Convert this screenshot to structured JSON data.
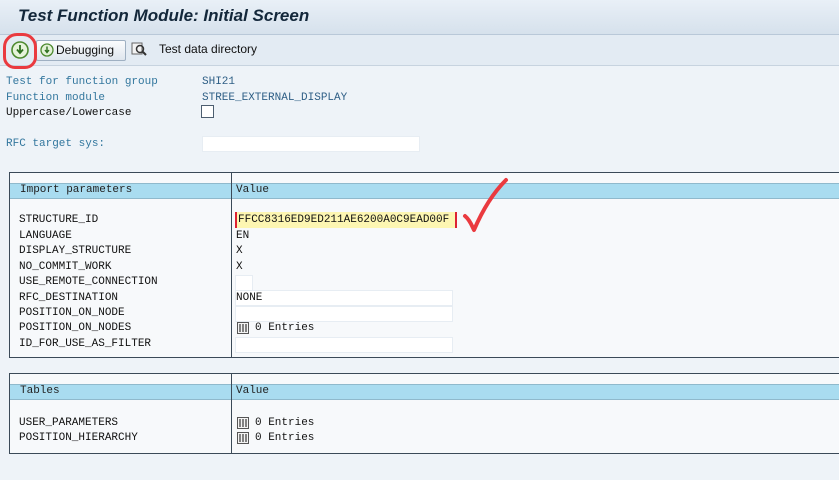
{
  "window": {
    "title": "Test Function Module: Initial Screen"
  },
  "toolbar": {
    "execute_icon": "execute-icon",
    "debugging_label": "Debugging",
    "test_data_directory_label": "Test data directory"
  },
  "header_fields": [
    {
      "label": "Test for function group",
      "value": "SHI21"
    },
    {
      "label": "Function module",
      "value": "STREE_EXTERNAL_DISPLAY"
    },
    {
      "label": "Uppercase/Lowercase",
      "value": ""
    },
    {
      "label": "RFC target sys:",
      "value": ""
    }
  ],
  "import_table": {
    "col_param": "Import parameters",
    "col_value": "Value",
    "rows": [
      {
        "name": "STRUCTURE_ID",
        "value": "FFCC8316ED9ED211AE6200A0C9EAD00F"
      },
      {
        "name": "LANGUAGE",
        "value": "EN"
      },
      {
        "name": "DISPLAY_STRUCTURE",
        "value": "X"
      },
      {
        "name": "NO_COMMIT_WORK",
        "value": "X"
      },
      {
        "name": "USE_REMOTE_CONNECTION",
        "value": ""
      },
      {
        "name": "RFC_DESTINATION",
        "value": "NONE"
      },
      {
        "name": "POSITION_ON_NODE",
        "value": ""
      },
      {
        "name": "POSITION_ON_NODES",
        "value": "0 Entries"
      },
      {
        "name": "ID_FOR_USE_AS_FILTER",
        "value": ""
      }
    ]
  },
  "tables_table": {
    "col_param": "Tables",
    "col_value": "Value",
    "rows": [
      {
        "name": "USER_PARAMETERS",
        "value": "0 Entries"
      },
      {
        "name": "POSITION_HIERARCHY",
        "value": "0 Entries"
      }
    ]
  },
  "colors": {
    "table_header": "#a9dcf0",
    "highlight": "#fdf6b2",
    "annotation_red": "#ea3a3f"
  }
}
